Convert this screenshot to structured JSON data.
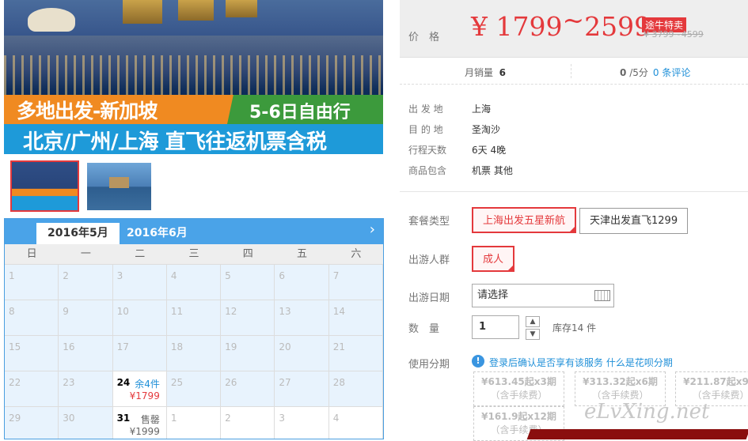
{
  "banner": {
    "line1": "多地出发-新加坡",
    "line1_right": "5-6日自由行",
    "line2": "北京/广州/上海  直飞往返机票含税"
  },
  "calendar": {
    "tabs": [
      "2016年5月",
      "2016年6月"
    ],
    "next_icon": "chevron-right-icon",
    "weekdays": [
      "日",
      "一",
      "二",
      "三",
      "四",
      "五",
      "六"
    ],
    "weeks": [
      [
        {
          "d": "1"
        },
        {
          "d": "2"
        },
        {
          "d": "3"
        },
        {
          "d": "4"
        },
        {
          "d": "5"
        },
        {
          "d": "6"
        },
        {
          "d": "7"
        }
      ],
      [
        {
          "d": "8"
        },
        {
          "d": "9"
        },
        {
          "d": "10"
        },
        {
          "d": "11"
        },
        {
          "d": "12"
        },
        {
          "d": "13"
        },
        {
          "d": "14"
        }
      ],
      [
        {
          "d": "15"
        },
        {
          "d": "16"
        },
        {
          "d": "17"
        },
        {
          "d": "18"
        },
        {
          "d": "19"
        },
        {
          "d": "20"
        },
        {
          "d": "21"
        }
      ],
      [
        {
          "d": "22"
        },
        {
          "d": "23"
        },
        {
          "d": "24",
          "status": "余4件",
          "price": "¥1799",
          "avail": true
        },
        {
          "d": "25"
        },
        {
          "d": "26"
        },
        {
          "d": "27"
        },
        {
          "d": "28"
        }
      ],
      [
        {
          "d": "29"
        },
        {
          "d": "30"
        },
        {
          "d": "31",
          "status": "售罄",
          "price": "¥1999",
          "avail": true,
          "sold": true
        },
        {
          "d": "1",
          "white": true
        },
        {
          "d": "2",
          "white": true
        },
        {
          "d": "3",
          "white": true
        },
        {
          "d": "4",
          "white": true
        }
      ]
    ]
  },
  "price": {
    "label": "价　格",
    "currency": "¥",
    "low": "1799",
    "tilde": "~",
    "high": "2599",
    "badge": "途牛特卖",
    "old": "¥ 3799~4599"
  },
  "stats": {
    "monthly_sales_label": "月销量",
    "monthly_sales": "6",
    "score": "0",
    "score_suffix": "/5分",
    "reviews": "0 条评论"
  },
  "details": [
    {
      "k": "出 发 地",
      "v": "上海"
    },
    {
      "k": "目 的 地",
      "v": "圣淘沙"
    },
    {
      "k": "行程天数",
      "v": "6天 4晚"
    },
    {
      "k": "商品包含",
      "v": "机票  其他"
    }
  ],
  "options": {
    "package_label": "套餐类型",
    "packages": [
      "上海出发五星新航",
      "天津出发直飞1299"
    ],
    "people_label": "出游人群",
    "people": [
      "成人"
    ],
    "date_label": "出游日期",
    "date_placeholder": "请选择",
    "qty_label": "数　量",
    "qty_value": "1",
    "stock": "库存14 件",
    "installment_label": "使用分期",
    "installment_note": "登录后确认是否享有该服务 什么是花呗分期"
  },
  "installments": [
    {
      "amount": "¥613.45起x3期",
      "fee": "（含手续费）"
    },
    {
      "amount": "¥313.32起x6期",
      "fee": "（含手续费）"
    },
    {
      "amount": "¥211.87起x9期",
      "fee": "（含手续费）"
    },
    {
      "amount": "¥161.9起x12期",
      "fee": "（含手续费）"
    }
  ],
  "watermark": "eLvXing.net",
  "colors": {
    "accent": "#e4393c",
    "link": "#1e8fd8",
    "calendar_header": "#4aa3e8"
  }
}
